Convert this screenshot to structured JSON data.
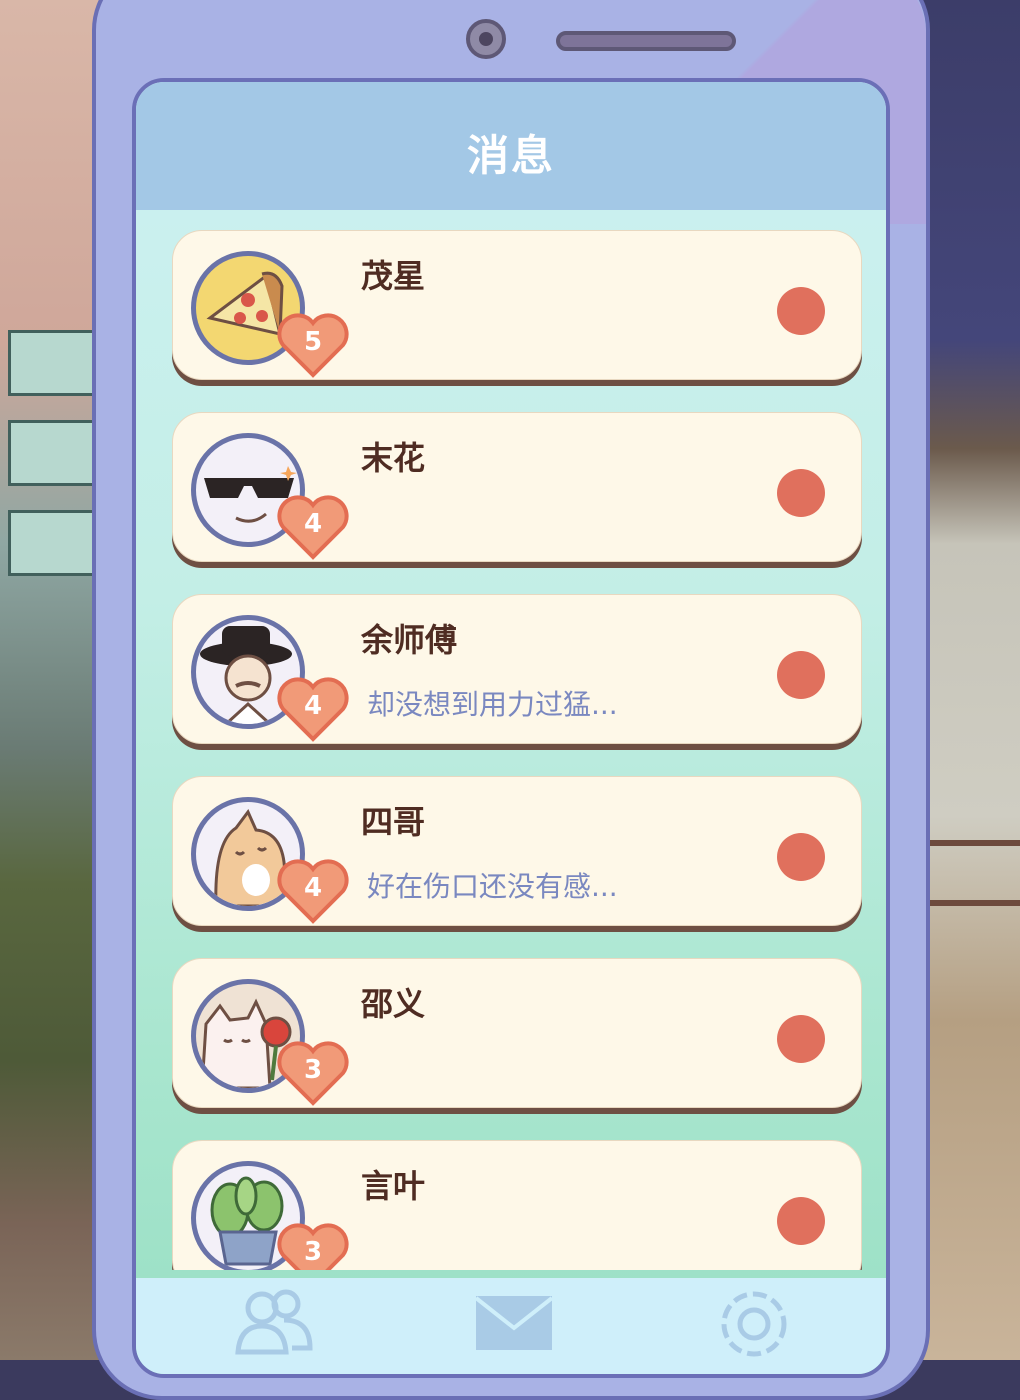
{
  "screen": {
    "title": "消息"
  },
  "contacts": [
    {
      "name": "茂星",
      "preview": "",
      "level": "5",
      "avatar": "pizza-avatar"
    },
    {
      "name": "末花",
      "preview": "",
      "level": "4",
      "avatar": "sunglasses-avatar"
    },
    {
      "name": "余师傅",
      "preview": "却没想到用力过猛...",
      "level": "4",
      "avatar": "hat-man-avatar"
    },
    {
      "name": "四哥",
      "preview": "好在伤口还没有感...",
      "level": "4",
      "avatar": "cat-avatar"
    },
    {
      "name": "邵义",
      "preview": "",
      "level": "3",
      "avatar": "cat-rose-avatar"
    },
    {
      "name": "言叶",
      "preview": "",
      "level": "3",
      "avatar": "plant-avatar"
    }
  ],
  "tabs": [
    {
      "icon": "contacts-icon"
    },
    {
      "icon": "mail-icon"
    },
    {
      "icon": "flower-icon"
    }
  ],
  "colors": {
    "accent": "#e0705d",
    "header": "#a3c8e6",
    "card": "#fef8e8",
    "name": "#4f2c22",
    "preview": "#7a88c0"
  }
}
